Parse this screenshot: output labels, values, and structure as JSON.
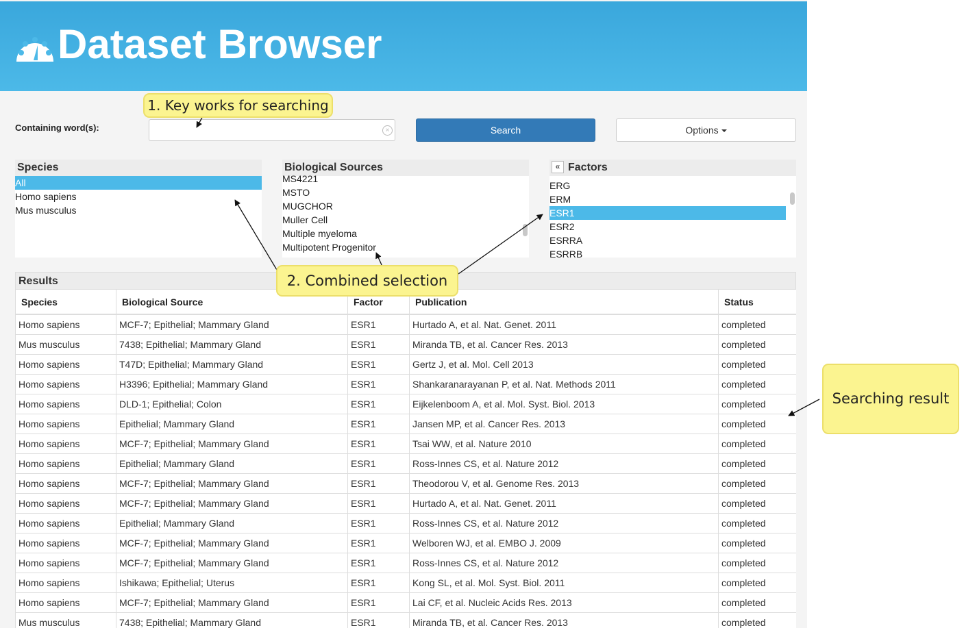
{
  "app": {
    "title": "Dataset Browser"
  },
  "search": {
    "label": "Containing word(s):",
    "value": "",
    "placeholder": "",
    "search_button": "Search",
    "options_button": "Options"
  },
  "species": {
    "header": "Species",
    "items": [
      "All",
      "Homo sapiens",
      "Mus musculus"
    ],
    "selected": "All"
  },
  "biological_sources": {
    "header": "Biological Sources",
    "items": [
      "MS4221",
      "MSTO",
      "MUGCHOR",
      "Muller Cell",
      "Multiple myeloma",
      "Multipotent Progenitor"
    ]
  },
  "factors": {
    "header": "Factors",
    "collapse_icon": "«",
    "items": [
      "ERG",
      "ERM",
      "ESR1",
      "ESR2",
      "ESRRA",
      "ESRRB"
    ],
    "selected": "ESR1"
  },
  "results": {
    "header": "Results",
    "columns": [
      "Species",
      "Biological Source",
      "Factor",
      "Publication",
      "Status"
    ],
    "rows": [
      [
        "Homo sapiens",
        "MCF-7; Epithelial; Mammary Gland",
        "ESR1",
        "Hurtado A, et al. Nat. Genet. 2011",
        "completed"
      ],
      [
        "Mus musculus",
        "7438; Epithelial; Mammary Gland",
        "ESR1",
        "Miranda TB, et al. Cancer Res. 2013",
        "completed"
      ],
      [
        "Homo sapiens",
        "T47D; Epithelial; Mammary Gland",
        "ESR1",
        "Gertz J, et al. Mol. Cell 2013",
        "completed"
      ],
      [
        "Homo sapiens",
        "H3396; Epithelial; Mammary Gland",
        "ESR1",
        "Shankaranarayanan P, et al. Nat. Methods 2011",
        "completed"
      ],
      [
        "Homo sapiens",
        "DLD-1; Epithelial; Colon",
        "ESR1",
        "Eijkelenboom A, et al. Mol. Syst. Biol. 2013",
        "completed"
      ],
      [
        "Homo sapiens",
        "Epithelial; Mammary Gland",
        "ESR1",
        "Jansen MP, et al. Cancer Res. 2013",
        "completed"
      ],
      [
        "Homo sapiens",
        "MCF-7; Epithelial; Mammary Gland",
        "ESR1",
        "Tsai WW, et al. Nature 2010",
        "completed"
      ],
      [
        "Homo sapiens",
        "Epithelial; Mammary Gland",
        "ESR1",
        "Ross-Innes CS, et al. Nature 2012",
        "completed"
      ],
      [
        "Homo sapiens",
        "MCF-7; Epithelial; Mammary Gland",
        "ESR1",
        "Theodorou V, et al. Genome Res. 2013",
        "completed"
      ],
      [
        "Homo sapiens",
        "MCF-7; Epithelial; Mammary Gland",
        "ESR1",
        "Hurtado A, et al. Nat. Genet. 2011",
        "completed"
      ],
      [
        "Homo sapiens",
        "Epithelial; Mammary Gland",
        "ESR1",
        "Ross-Innes CS, et al. Nature 2012",
        "completed"
      ],
      [
        "Homo sapiens",
        "MCF-7; Epithelial; Mammary Gland",
        "ESR1",
        "Welboren WJ, et al. EMBO J. 2009",
        "completed"
      ],
      [
        "Homo sapiens",
        "MCF-7; Epithelial; Mammary Gland",
        "ESR1",
        "Ross-Innes CS, et al. Nature 2012",
        "completed"
      ],
      [
        "Homo sapiens",
        "Ishikawa; Epithelial; Uterus",
        "ESR1",
        "Kong SL, et al. Mol. Syst. Biol. 2011",
        "completed"
      ],
      [
        "Homo sapiens",
        "MCF-7; Epithelial; Mammary Gland",
        "ESR1",
        "Lai CF, et al. Nucleic Acids Res. 2013",
        "completed"
      ],
      [
        "Mus musculus",
        "7438; Epithelial; Mammary Gland",
        "ESR1",
        "Miranda TB, et al. Cancer Res. 2013",
        "completed"
      ]
    ]
  },
  "annotations": {
    "callout_1": "1. Key works for searching",
    "callout_2": "2. Combined selection",
    "callout_3": "Searching result"
  },
  "colors": {
    "header_bg": "#4cb9e8",
    "selection": "#4cb9e8",
    "primary_button": "#337ab7",
    "callout_bg": "#fbf490"
  }
}
